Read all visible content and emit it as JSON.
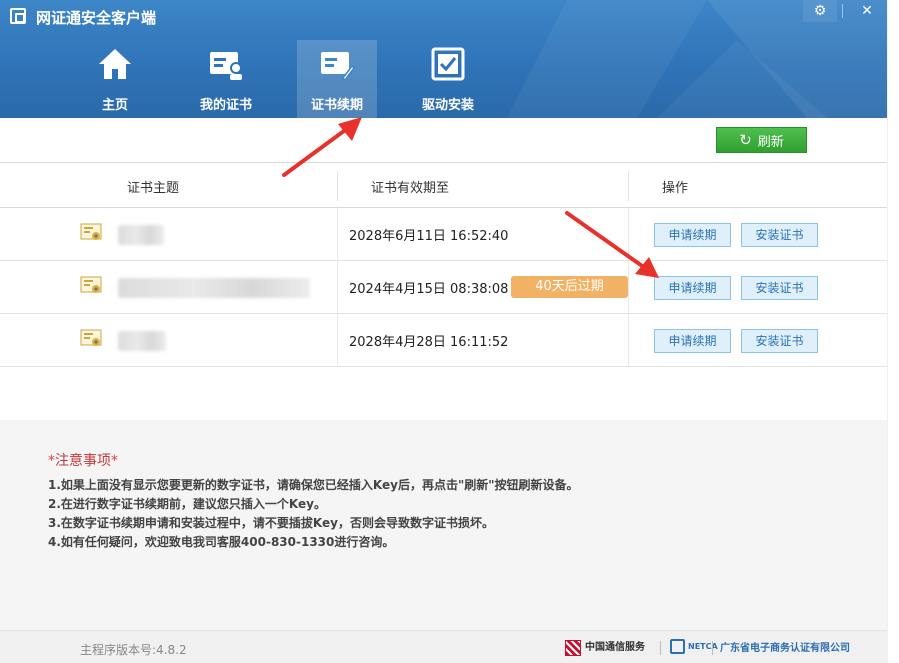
{
  "app": {
    "title": "网证通安全客户端"
  },
  "nav": {
    "items": [
      {
        "label": "主页",
        "icon": "home-icon"
      },
      {
        "label": "我的证书",
        "icon": "id-card-icon"
      },
      {
        "label": "证书续期",
        "icon": "certificate-renew-icon",
        "active": true
      },
      {
        "label": "驱动安装",
        "icon": "checkbox-icon"
      }
    ]
  },
  "toolbar": {
    "refresh_label": "刷新"
  },
  "table": {
    "headers": [
      "证书主题",
      "证书有效期至",
      "操作"
    ],
    "rows": [
      {
        "expiry": "2028年6月11日 16:52:40",
        "badge": "",
        "renew": "申请续期",
        "install": "安装证书"
      },
      {
        "expiry": "2024年4月15日 08:38:08",
        "badge": "40天后过期",
        "renew": "申请续期",
        "install": "安装证书"
      },
      {
        "expiry": "2028年4月28日 16:11:52",
        "badge": "",
        "renew": "申请续期",
        "install": "安装证书"
      }
    ]
  },
  "notice": {
    "star": "*",
    "title": "注意事项",
    "lines": [
      "1.如果上面没有显示您要更新的数字证书，请确保您已经插入Key后，再点击\"刷新\"按钮刷新设备。",
      "2.在进行数字证书续期前，建议您只插入一个Key。",
      "3.在数字证书续期申请和安装过程中，请不要插拔Key，否则会导致数字证书损坏。",
      "4.如有任何疑问，欢迎致电我司客服400-830-1330进行咨询。"
    ]
  },
  "footer": {
    "version": "主程序版本号:4.8.2",
    "logo_china_comservice": "中国通信服务",
    "logo_netca": "NETCA",
    "logo_gd": "广东省电子商务认证有限公司"
  },
  "colors": {
    "header_blue": "#2f74b8",
    "refresh_green": "#3aa93a",
    "badge_orange": "#f2b266",
    "notice_red": "#c03a3a",
    "arrow_red": "#e8312a"
  }
}
